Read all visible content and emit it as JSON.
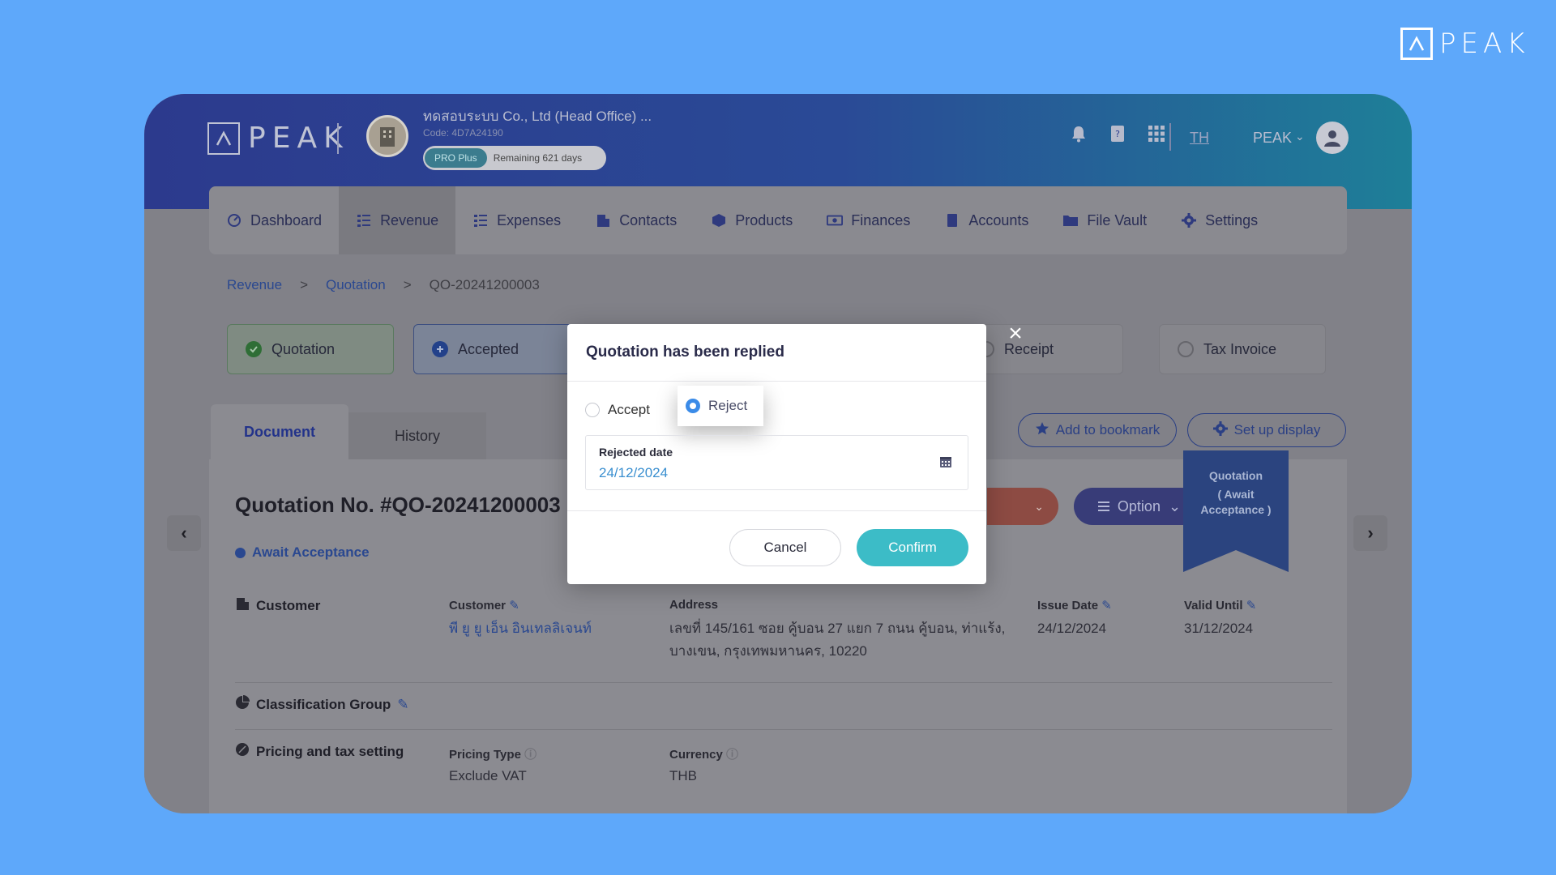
{
  "outer_brand": {
    "wordmark": "PEAK"
  },
  "header": {
    "logo_text": "PEAK",
    "company_name": "ทดสอบระบบ Co., Ltd (Head Office) ...",
    "company_code": "Code: 4D7A24190",
    "plan": "PRO Plus",
    "remaining": "Remaining 621 days",
    "language": "TH",
    "user_name": "PEAK"
  },
  "nav": {
    "items": [
      {
        "label": "Dashboard",
        "icon": "dashboard-icon"
      },
      {
        "label": "Revenue",
        "icon": "revenue-icon",
        "active": true
      },
      {
        "label": "Expenses",
        "icon": "expenses-icon"
      },
      {
        "label": "Contacts",
        "icon": "contacts-icon"
      },
      {
        "label": "Products",
        "icon": "products-icon"
      },
      {
        "label": "Finances",
        "icon": "finances-icon"
      },
      {
        "label": "Accounts",
        "icon": "accounts-icon"
      },
      {
        "label": "File Vault",
        "icon": "folder-icon"
      },
      {
        "label": "Settings",
        "icon": "gear-icon"
      }
    ]
  },
  "breadcrumb": {
    "level1": "Revenue",
    "level2": "Quotation",
    "current": "QO-20241200003",
    "separator": ">"
  },
  "steps": {
    "quotation": "Quotation",
    "accepted": "Accepted",
    "receipt": "Receipt",
    "tax_invoice": "Tax Invoice"
  },
  "tabs": {
    "document": "Document",
    "history": "History"
  },
  "actions": {
    "bookmark": "Add to bookmark",
    "setup": "Set up display",
    "option": "Option"
  },
  "document": {
    "title": "Quotation No. #QO-20241200003",
    "status": "Await Acceptance",
    "ribbon_line1": "Quotation",
    "ribbon_line2": "( Await",
    "ribbon_line3": "Acceptance )"
  },
  "customer_section": {
    "label": "Customer",
    "customer_label": "Customer",
    "customer_value": "พี ยู ยู เอ็น อินเทลลิเจนท์",
    "address_label": "Address",
    "address_line1": "เลขที่ 145/161 ซอย คู้บอน 27 แยก 7 ถนน คู้บอน, ท่าแร้ง,",
    "address_line2": "บางเขน, กรุงเทพมหานคร, 10220",
    "issue_date_label": "Issue Date",
    "issue_date": "24/12/2024",
    "valid_until_label": "Valid Until",
    "valid_until": "31/12/2024"
  },
  "classification": {
    "label": "Classification Group"
  },
  "pricing": {
    "label": "Pricing and tax setting",
    "pricing_type_label": "Pricing Type",
    "pricing_type": "Exclude VAT",
    "currency_label": "Currency",
    "currency": "THB"
  },
  "modal": {
    "title": "Quotation has been replied",
    "accept_label": "Accept",
    "reject_label": "Reject",
    "selected": "Reject",
    "date_label": "Rejected date",
    "date_value": "24/12/2024",
    "cancel": "Cancel",
    "confirm": "Confirm"
  }
}
